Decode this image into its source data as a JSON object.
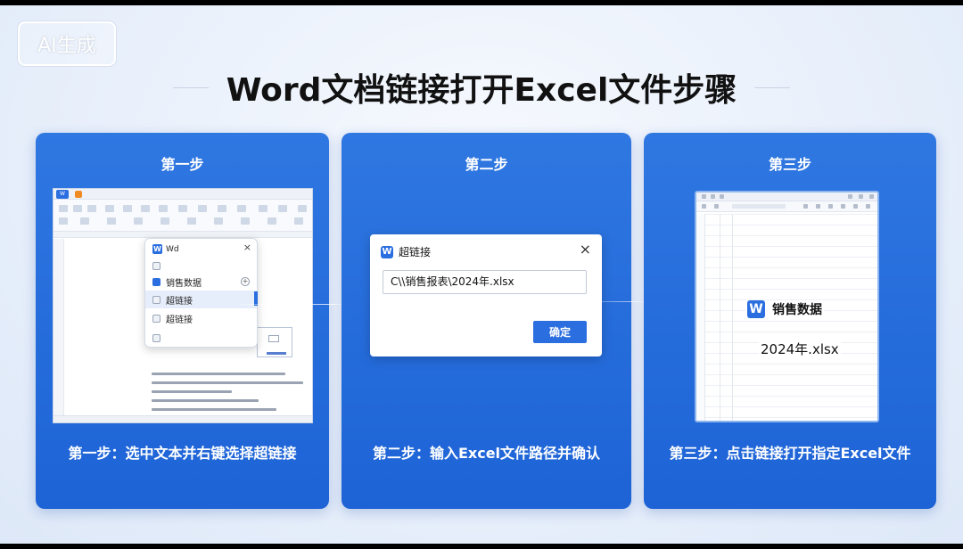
{
  "badge": "AI生成",
  "page_title": "Word文档链接打开Excel文件步骤",
  "steps": [
    {
      "heading": "第一步",
      "caption": "第一步：选中文本并右键选择超链接",
      "menu": {
        "app_logo": "W",
        "app_name": "Wd",
        "items": [
          "销售数据",
          "超链接",
          "超链接"
        ]
      }
    },
    {
      "heading": "第二步",
      "caption": "第二步：输入Excel文件路径并确认",
      "dialog": {
        "logo": "W",
        "title": "超链接",
        "path_value": "C\\\\销售报表\\2024年.xlsx",
        "ok_label": "确定"
      }
    },
    {
      "heading": "第三步",
      "caption": "第三步：点击链接打开指定Excel文件",
      "excel": {
        "logo": "W",
        "brand": "销售数据",
        "file_name": "2024年.xlsx"
      }
    }
  ],
  "colors": {
    "card_blue": "#2a6ee0",
    "accent": "#2a6ee0"
  }
}
